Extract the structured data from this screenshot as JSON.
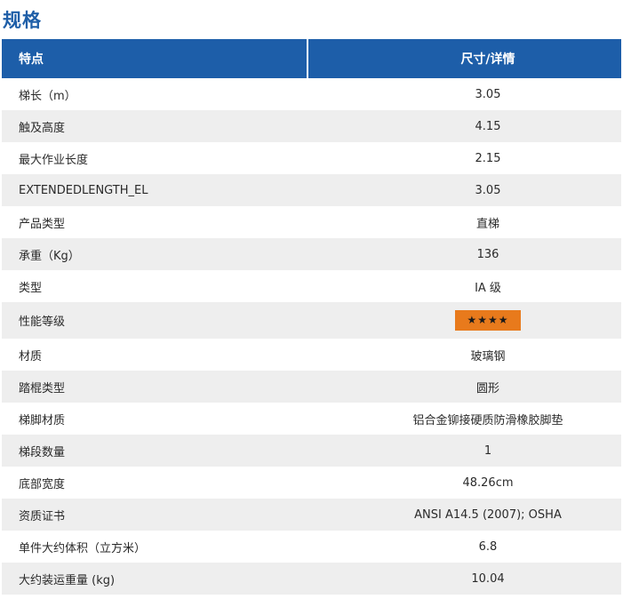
{
  "page": {
    "title": "规格"
  },
  "table": {
    "headers": {
      "feature": "特点",
      "detail": "尺寸/详情"
    },
    "rows": [
      {
        "feature": "梯长（m）",
        "value": "3.05"
      },
      {
        "feature": "触及高度",
        "value": "4.15"
      },
      {
        "feature": "最大作业长度",
        "value": "2.15"
      },
      {
        "feature": "EXTENDEDLENGTH_EL",
        "value": "3.05"
      },
      {
        "feature": "产品类型",
        "value": "直梯"
      },
      {
        "feature": "承重（Kg）",
        "value": "136"
      },
      {
        "feature": "类型",
        "value": "IA 级"
      },
      {
        "feature": "性能等级",
        "value": "★★★★"
      },
      {
        "feature": "材质",
        "value": "玻璃钢"
      },
      {
        "feature": "踏棍类型",
        "value": "圆形"
      },
      {
        "feature": "梯脚材质",
        "value": "铝合金铆接硬质防滑橡胶脚垫"
      },
      {
        "feature": "梯段数量",
        "value": "1"
      },
      {
        "feature": "底部宽度",
        "value": "48.26cm"
      },
      {
        "feature": "资质证书",
        "value": "ANSI A14.5 (2007); OSHA"
      },
      {
        "feature": "单件大约体积（立方米）",
        "value": "6.8"
      },
      {
        "feature": "大约装运重量 (kg)",
        "value": "10.04"
      }
    ]
  },
  "colors": {
    "title": "#1f5fa8",
    "header_background": "#1d5ea9",
    "row_alt_background": "#eeeeee",
    "rating_badge": "#e87a1c"
  }
}
